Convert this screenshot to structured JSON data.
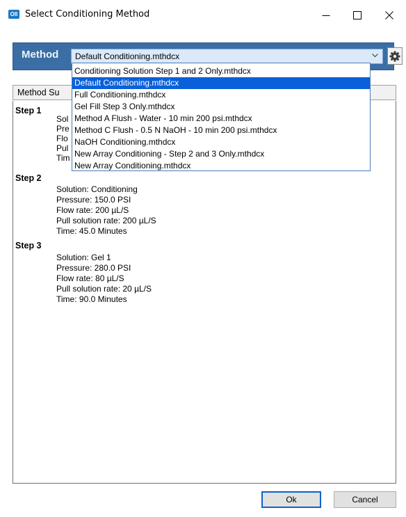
{
  "window": {
    "title": "Select Conditioning Method",
    "icon_text": "OII"
  },
  "method": {
    "label": "Method",
    "selected": "Default Conditioning.mthdcx",
    "options": [
      "Conditioning Solution Step 1 and 2 Only.mthdcx",
      "Default Conditioning.mthdcx",
      "Full Conditioning.mthdcx",
      "Gel Fill Step 3 Only.mthdcx",
      "Method A Flush - Water - 10 min 200 psi.mthdcx",
      "Method C Flush - 0.5 N NaOH - 10 min 200 psi.mthdcx",
      "NaOH Conditioning.mthdcx",
      "New Array Conditioning - Step 2 and 3 Only.mthdcx",
      "New Array Conditioning.mthdcx"
    ],
    "selected_index": 1
  },
  "summary": {
    "header": "Method Su",
    "steps": [
      {
        "title": "Step 1",
        "props": [
          "Sol",
          "Pre",
          "Flo",
          "Pul",
          "Tim"
        ]
      },
      {
        "title": "Step 2",
        "props": [
          "Solution: Conditioning",
          "Pressure: 150.0 PSI",
          "Flow rate: 200 µL/S",
          "Pull solution rate: 200 µL/S",
          "Time: 45.0 Minutes"
        ]
      },
      {
        "title": "Step 3",
        "props": [
          "Solution: Gel 1",
          "Pressure: 280.0 PSI",
          "Flow rate: 80 µL/S",
          "Pull solution rate: 20 µL/S",
          "Time: 90.0 Minutes"
        ]
      }
    ]
  },
  "buttons": {
    "ok": "Ok",
    "cancel": "Cancel"
  },
  "icons": {
    "window_controls": [
      "minimize-icon",
      "maximize-icon",
      "close-icon"
    ],
    "settings": "gear-icon",
    "combo": "chevron-down-icon"
  },
  "colors": {
    "method_bar": "#3a6ea5",
    "combo_bg": "#dbe9f8",
    "selection": "#0a60d8",
    "primary_border": "#0a62c9"
  }
}
